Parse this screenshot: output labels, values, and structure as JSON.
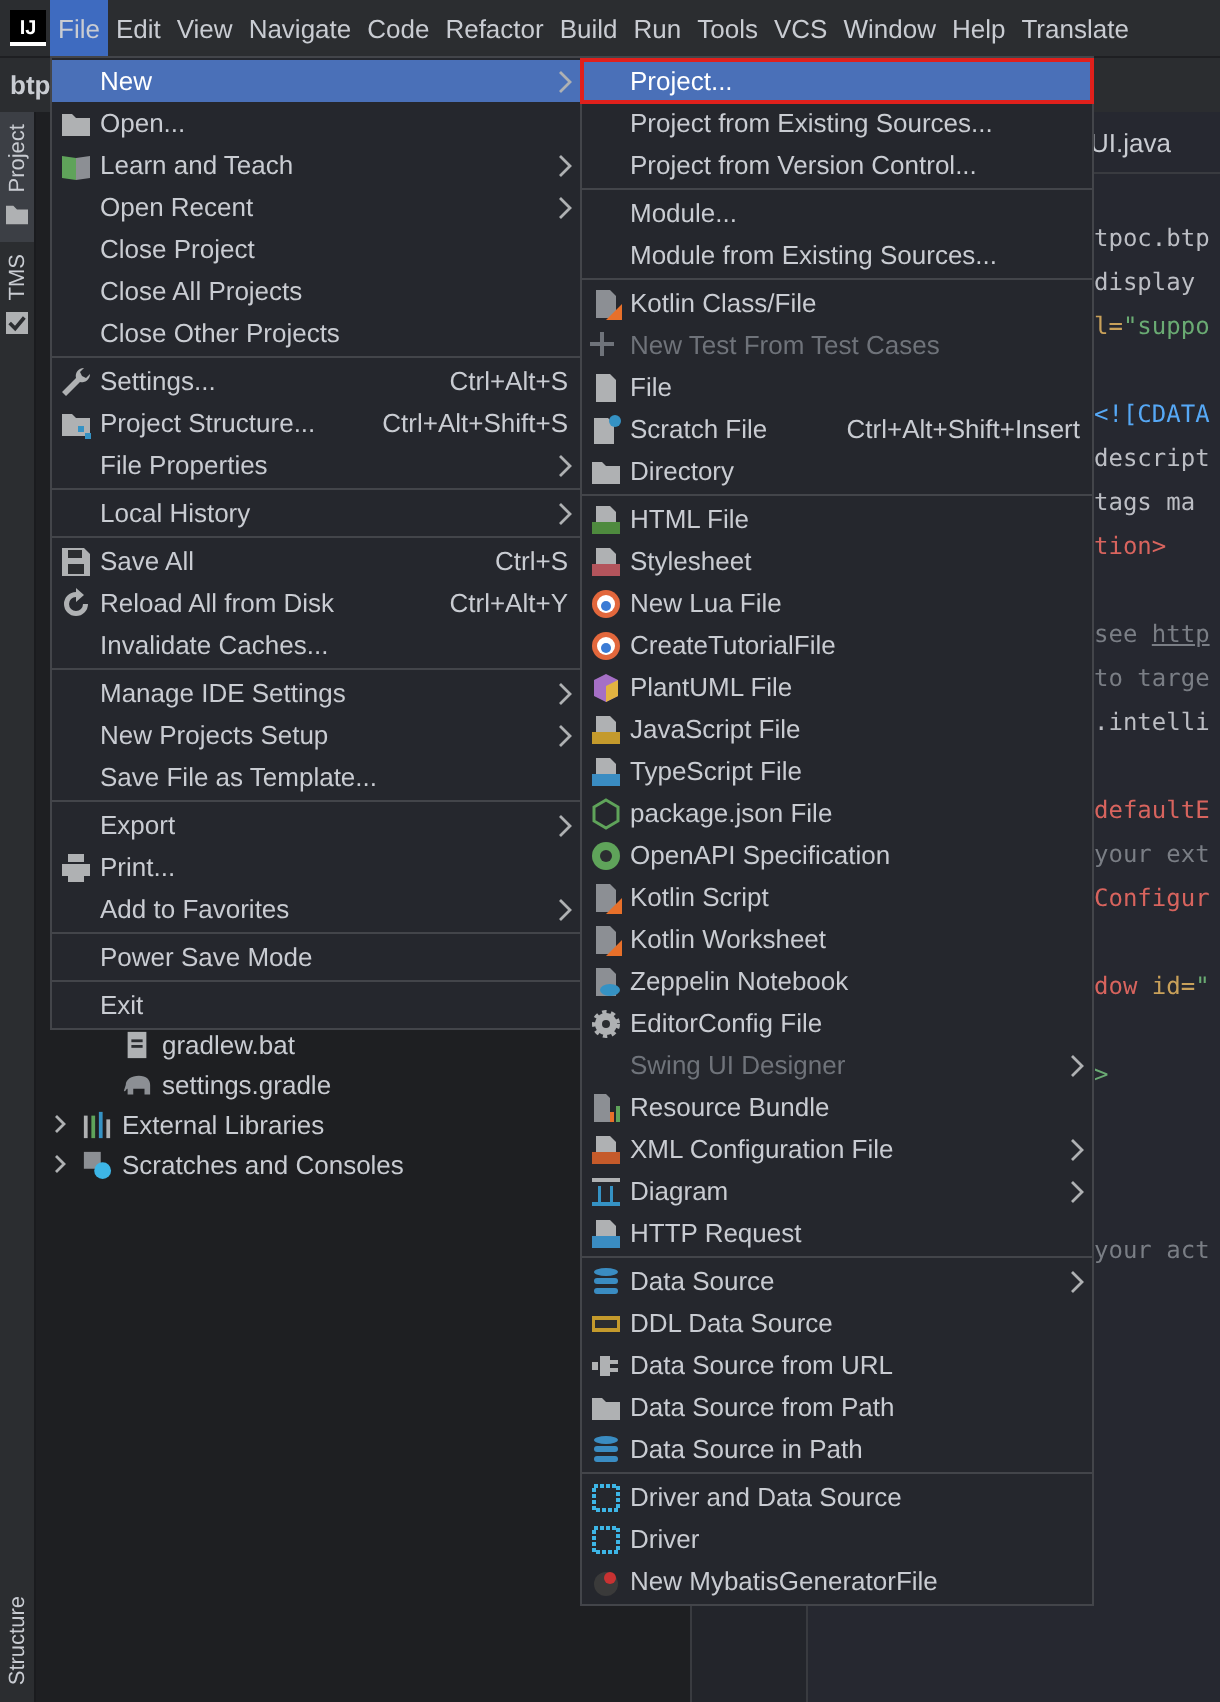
{
  "app_logo": "IJ",
  "menubar": [
    {
      "label": "File",
      "selected": true
    },
    {
      "label": "Edit",
      "selected": false
    },
    {
      "label": "View",
      "selected": false
    },
    {
      "label": "Navigate",
      "selected": false
    },
    {
      "label": "Code",
      "selected": false
    },
    {
      "label": "Refactor",
      "selected": false
    },
    {
      "label": "Build",
      "selected": false
    },
    {
      "label": "Run",
      "selected": false
    },
    {
      "label": "Tools",
      "selected": false
    },
    {
      "label": "VCS",
      "selected": false
    },
    {
      "label": "Window",
      "selected": false
    },
    {
      "label": "Help",
      "selected": false
    },
    {
      "label": "Translate",
      "selected": false
    }
  ],
  "navbar": {
    "project": "btp"
  },
  "tool_strip": {
    "top": [
      {
        "label": "Project",
        "selected": true
      },
      {
        "label": "TMS",
        "selected": false
      }
    ],
    "bottom": [
      {
        "label": "Structure",
        "selected": false
      }
    ]
  },
  "project_tree": [
    {
      "label": "gradlew.bat",
      "kind": "file"
    },
    {
      "label": "settings.gradle",
      "kind": "gradle"
    },
    {
      "label": "External Libraries",
      "kind": "libraries",
      "expanded": false
    },
    {
      "label": "Scratches and Consoles",
      "kind": "scratches",
      "expanded": false
    }
  ],
  "editor": {
    "tab": "UI.java",
    "lines": [
      {
        "kind": "code",
        "parts": [
          {
            "text": "tpoc.btp",
            "kind": "text"
          }
        ]
      },
      {
        "kind": "code",
        "parts": [
          {
            "text": "display",
            "kind": "text"
          }
        ]
      },
      {
        "kind": "code",
        "parts": [
          {
            "text": "l=",
            "kind": "attr"
          },
          {
            "text": "\"suppo",
            "kind": "value"
          }
        ]
      },
      {
        "kind": "blank"
      },
      {
        "kind": "code",
        "parts": [
          {
            "text": "<![CDATA",
            "kind": "cdata"
          }
        ]
      },
      {
        "kind": "code",
        "parts": [
          {
            "text": "descript",
            "kind": "text"
          }
        ]
      },
      {
        "kind": "code",
        "parts": [
          {
            "text": "tags ma",
            "kind": "text"
          }
        ]
      },
      {
        "kind": "code",
        "parts": [
          {
            "text": "tion>",
            "kind": "tag"
          }
        ]
      },
      {
        "kind": "blank"
      },
      {
        "kind": "code",
        "parts": [
          {
            "text": "see ",
            "kind": "comment"
          },
          {
            "text": "http",
            "kind": "link"
          }
        ]
      },
      {
        "kind": "code",
        "parts": [
          {
            "text": "to targe",
            "kind": "comment"
          }
        ]
      },
      {
        "kind": "code",
        "parts": [
          {
            "text": ".intelli",
            "kind": "text"
          }
        ]
      },
      {
        "kind": "blank"
      },
      {
        "kind": "code",
        "parts": [
          {
            "text": "defaultE",
            "kind": "tag"
          }
        ]
      },
      {
        "kind": "code",
        "parts": [
          {
            "text": "your ext",
            "kind": "comment"
          }
        ]
      },
      {
        "kind": "code",
        "parts": [
          {
            "text": "Configur",
            "kind": "tag"
          }
        ]
      },
      {
        "kind": "blank"
      },
      {
        "kind": "code",
        "parts": [
          {
            "text": "dow ",
            "kind": "tag"
          },
          {
            "text": "id=",
            "kind": "attr"
          },
          {
            "text": "\"",
            "kind": "value"
          }
        ]
      },
      {
        "kind": "blank"
      },
      {
        "kind": "code",
        "parts": [
          {
            "text": ">",
            "kind": "value"
          }
        ]
      },
      {
        "kind": "blank"
      },
      {
        "kind": "blank"
      },
      {
        "kind": "blank"
      },
      {
        "kind": "code",
        "parts": [
          {
            "text": "your act",
            "kind": "comment"
          }
        ]
      }
    ]
  },
  "file_menu": {
    "sections": [
      {
        "items": [
          {
            "label": "New",
            "submenu": true,
            "selected": true
          },
          {
            "label": "Open...",
            "submenu": false,
            "selected": false
          },
          {
            "label": "Learn and Teach",
            "submenu": true,
            "selected": false
          },
          {
            "label": "Open Recent",
            "submenu": true,
            "selected": false
          },
          {
            "label": "Close Project",
            "submenu": false,
            "selected": false
          },
          {
            "label": "Close All Projects",
            "submenu": false,
            "selected": false
          },
          {
            "label": "Close Other Projects",
            "submenu": false,
            "selected": false
          }
        ]
      },
      {
        "items": [
          {
            "label": "Settings...",
            "shortcut": "Ctrl+Alt+S",
            "submenu": false,
            "selected": false
          },
          {
            "label": "Project Structure...",
            "shortcut": "Ctrl+Alt+Shift+S",
            "submenu": false,
            "selected": false
          },
          {
            "label": "File Properties",
            "submenu": true,
            "selected": false
          }
        ]
      },
      {
        "items": [
          {
            "label": "Local History",
            "submenu": true,
            "selected": false
          }
        ]
      },
      {
        "items": [
          {
            "label": "Save All",
            "shortcut": "Ctrl+S",
            "submenu": false,
            "selected": false
          },
          {
            "label": "Reload All from Disk",
            "shortcut": "Ctrl+Alt+Y",
            "submenu": false,
            "selected": false
          },
          {
            "label": "Invalidate Caches...",
            "submenu": false,
            "selected": false
          }
        ]
      },
      {
        "items": [
          {
            "label": "Manage IDE Settings",
            "submenu": true,
            "selected": false
          },
          {
            "label": "New Projects Setup",
            "submenu": true,
            "selected": false
          },
          {
            "label": "Save File as Template...",
            "submenu": false,
            "selected": false
          }
        ]
      },
      {
        "items": [
          {
            "label": "Export",
            "submenu": true,
            "selected": false
          },
          {
            "label": "Print...",
            "submenu": false,
            "selected": false
          },
          {
            "label": "Add to Favorites",
            "submenu": true,
            "selected": false
          }
        ]
      },
      {
        "items": [
          {
            "label": "Power Save Mode",
            "submenu": false,
            "selected": false
          }
        ]
      },
      {
        "items": [
          {
            "label": "Exit",
            "submenu": false,
            "selected": false
          }
        ]
      }
    ]
  },
  "new_submenu": {
    "sections": [
      {
        "items": [
          {
            "label": "Project...",
            "submenu": false,
            "selected": true,
            "disabled": false,
            "outlined": true
          },
          {
            "label": "Project from Existing Sources...",
            "submenu": false,
            "selected": false,
            "disabled": false,
            "outlined": false
          },
          {
            "label": "Project from Version Control...",
            "submenu": false,
            "selected": false,
            "disabled": false,
            "outlined": false
          }
        ]
      },
      {
        "items": [
          {
            "label": "Module...",
            "submenu": false,
            "selected": false,
            "disabled": false,
            "outlined": false
          },
          {
            "label": "Module from Existing Sources...",
            "submenu": false,
            "selected": false,
            "disabled": false,
            "outlined": false
          }
        ]
      },
      {
        "items": [
          {
            "label": "Kotlin Class/File",
            "submenu": false,
            "selected": false,
            "disabled": false,
            "outlined": false
          },
          {
            "label": "New Test From Test Cases",
            "submenu": false,
            "selected": false,
            "disabled": true,
            "outlined": false
          },
          {
            "label": "File",
            "submenu": false,
            "selected": false,
            "disabled": false,
            "outlined": false
          },
          {
            "label": "Scratch File",
            "shortcut": "Ctrl+Alt+Shift+Insert",
            "submenu": false,
            "selected": false,
            "disabled": false,
            "outlined": false
          },
          {
            "label": "Directory",
            "submenu": false,
            "selected": false,
            "disabled": false,
            "outlined": false
          }
        ]
      },
      {
        "items": [
          {
            "label": "HTML File",
            "submenu": false,
            "selected": false,
            "disabled": false,
            "outlined": false
          },
          {
            "label": "Stylesheet",
            "submenu": false,
            "selected": false,
            "disabled": false,
            "outlined": false
          },
          {
            "label": "New Lua File",
            "submenu": false,
            "selected": false,
            "disabled": false,
            "outlined": false
          },
          {
            "label": "CreateTutorialFile",
            "submenu": false,
            "selected": false,
            "disabled": false,
            "outlined": false
          },
          {
            "label": "PlantUML File",
            "submenu": false,
            "selected": false,
            "disabled": false,
            "outlined": false
          },
          {
            "label": "JavaScript File",
            "submenu": false,
            "selected": false,
            "disabled": false,
            "outlined": false
          },
          {
            "label": "TypeScript File",
            "submenu": false,
            "selected": false,
            "disabled": false,
            "outlined": false
          },
          {
            "label": "package.json File",
            "submenu": false,
            "selected": false,
            "disabled": false,
            "outlined": false
          },
          {
            "label": "OpenAPI Specification",
            "submenu": false,
            "selected": false,
            "disabled": false,
            "outlined": false
          },
          {
            "label": "Kotlin Script",
            "submenu": false,
            "selected": false,
            "disabled": false,
            "outlined": false
          },
          {
            "label": "Kotlin Worksheet",
            "submenu": false,
            "selected": false,
            "disabled": false,
            "outlined": false
          },
          {
            "label": "Zeppelin Notebook",
            "submenu": false,
            "selected": false,
            "disabled": false,
            "outlined": false
          },
          {
            "label": "EditorConfig File",
            "submenu": false,
            "selected": false,
            "disabled": false,
            "outlined": false
          },
          {
            "label": "Swing UI Designer",
            "submenu": true,
            "selected": false,
            "disabled": true,
            "outlined": false
          },
          {
            "label": "Resource Bundle",
            "submenu": false,
            "selected": false,
            "disabled": false,
            "outlined": false
          },
          {
            "label": "XML Configuration File",
            "submenu": true,
            "selected": false,
            "disabled": false,
            "outlined": false
          },
          {
            "label": "Diagram",
            "submenu": true,
            "selected": false,
            "disabled": false,
            "outlined": false
          },
          {
            "label": "HTTP Request",
            "submenu": false,
            "selected": false,
            "disabled": false,
            "outlined": false
          }
        ]
      },
      {
        "items": [
          {
            "label": "Data Source",
            "submenu": true,
            "selected": false,
            "disabled": false,
            "outlined": false
          },
          {
            "label": "DDL Data Source",
            "submenu": false,
            "selected": false,
            "disabled": false,
            "outlined": false
          },
          {
            "label": "Data Source from URL",
            "submenu": false,
            "selected": false,
            "disabled": false,
            "outlined": false
          },
          {
            "label": "Data Source from Path",
            "submenu": false,
            "selected": false,
            "disabled": false,
            "outlined": false
          },
          {
            "label": "Data Source in Path",
            "submenu": false,
            "selected": false,
            "disabled": false,
            "outlined": false
          }
        ]
      },
      {
        "items": [
          {
            "label": "Driver and Data Source",
            "submenu": false,
            "selected": false,
            "disabled": false,
            "outlined": false
          },
          {
            "label": "Driver",
            "submenu": false,
            "selected": false,
            "disabled": false,
            "outlined": false
          },
          {
            "label": "New MybatisGeneratorFile",
            "submenu": false,
            "selected": false,
            "disabled": false,
            "outlined": false
          }
        ]
      }
    ]
  }
}
